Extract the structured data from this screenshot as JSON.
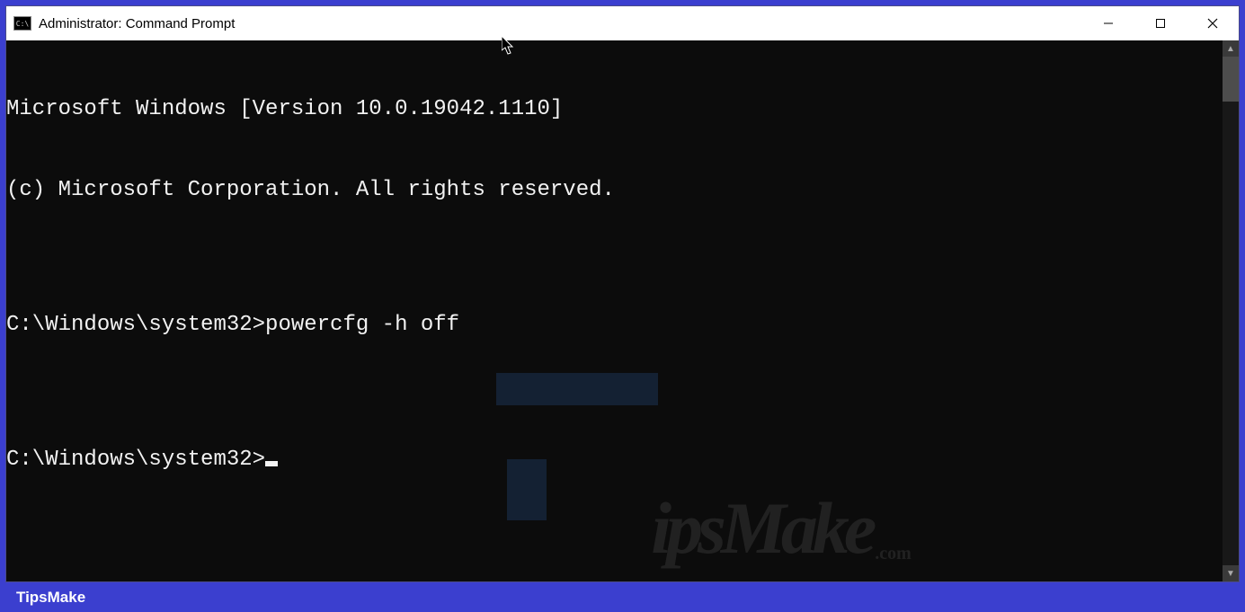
{
  "window": {
    "title": "Administrator: Command Prompt",
    "icon_name": "cmd-icon"
  },
  "terminal": {
    "lines": [
      "Microsoft Windows [Version 10.0.19042.1110]",
      "(c) Microsoft Corporation. All rights reserved.",
      "",
      "C:\\Windows\\system32>powercfg -h off",
      "",
      "C:\\Windows\\system32>"
    ],
    "prompt_path": "C:\\Windows\\system32>",
    "last_command": "powercfg -h off",
    "windows_version": "10.0.19042.1110"
  },
  "watermark": {
    "brand": "TipsMake",
    "suffix": ".com"
  },
  "footer": {
    "label": "TipsMake"
  },
  "colors": {
    "frame": "#3b3fcf",
    "terminal_bg": "#0c0c0c",
    "terminal_fg": "#f2f2f2",
    "titlebar_bg": "#ffffff"
  }
}
